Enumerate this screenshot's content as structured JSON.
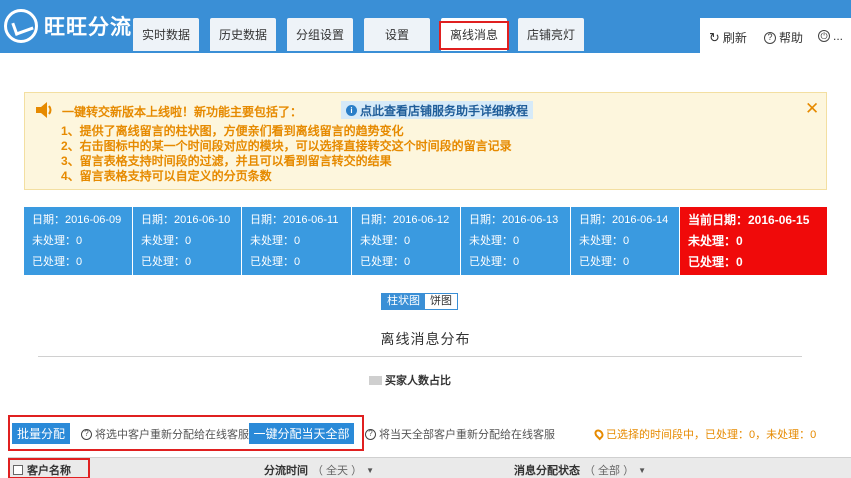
{
  "app": {
    "title": "旺旺分流"
  },
  "tabs": [
    {
      "label": "实时数据"
    },
    {
      "label": "历史数据"
    },
    {
      "label": "分组设置"
    },
    {
      "label": "设置"
    },
    {
      "label": "离线消息"
    },
    {
      "label": "店铺亮灯"
    }
  ],
  "header_actions": {
    "refresh": "刷新",
    "help": "帮助"
  },
  "notice": {
    "headline": "一键转交新版本上线啦！新功能主要包括了：",
    "link": "点此查看店铺服务助手详细教程",
    "lines": [
      "1、提供了离线留言的柱状图，方便亲们看到离线留言的趋势变化",
      "2、右击图标中的某一个时间段对应的模块，可以选择直接转交这个时间段的留言记录",
      "3、留言表格支持时间段的过滤，并且可以看到留言转交的结果",
      "4、留言表格支持可以自定义的分页条数"
    ]
  },
  "date_cards": [
    {
      "date": "日期：2016-06-09",
      "pending": "未处理：0",
      "done": "已处理：0"
    },
    {
      "date": "日期：2016-06-10",
      "pending": "未处理：0",
      "done": "已处理：0"
    },
    {
      "date": "日期：2016-06-11",
      "pending": "未处理：0",
      "done": "已处理：0"
    },
    {
      "date": "日期：2016-06-12",
      "pending": "未处理：0",
      "done": "已处理：0"
    },
    {
      "date": "日期：2016-06-13",
      "pending": "未处理：0",
      "done": "已处理：0"
    },
    {
      "date": "日期：2016-06-14",
      "pending": "未处理：0",
      "done": "已处理：0"
    },
    {
      "date": "当前日期：2016-06-15",
      "pending": "未处理：0",
      "done": "已处理：0"
    }
  ],
  "chart": {
    "toggle_bar": "柱状图",
    "toggle_pie": "饼图",
    "title": "离线消息分布",
    "legend": "买家人数占比"
  },
  "actions": {
    "batch_assign": "批量分配",
    "batch_hint": "将选中客户重新分配给在线客服",
    "assign_all": "一键分配当天全部",
    "assign_all_hint": "将当天全部客户重新分配给在线客服",
    "selection_info": "已选择的时间段中，已处理：0，未处理：0"
  },
  "table": {
    "col_customer": "客户名称",
    "col_time": "分流时间",
    "col_time_filter": "（ 全天 ）",
    "col_status": "消息分配状态",
    "col_status_filter": "（ 全部 ）"
  },
  "colors": {
    "header_blue": "#3a8fd6",
    "card_blue": "#3a9ae0",
    "card_today": "#f00a0a",
    "notice_text": "#e68a00",
    "highlight_red": "#e02020"
  }
}
